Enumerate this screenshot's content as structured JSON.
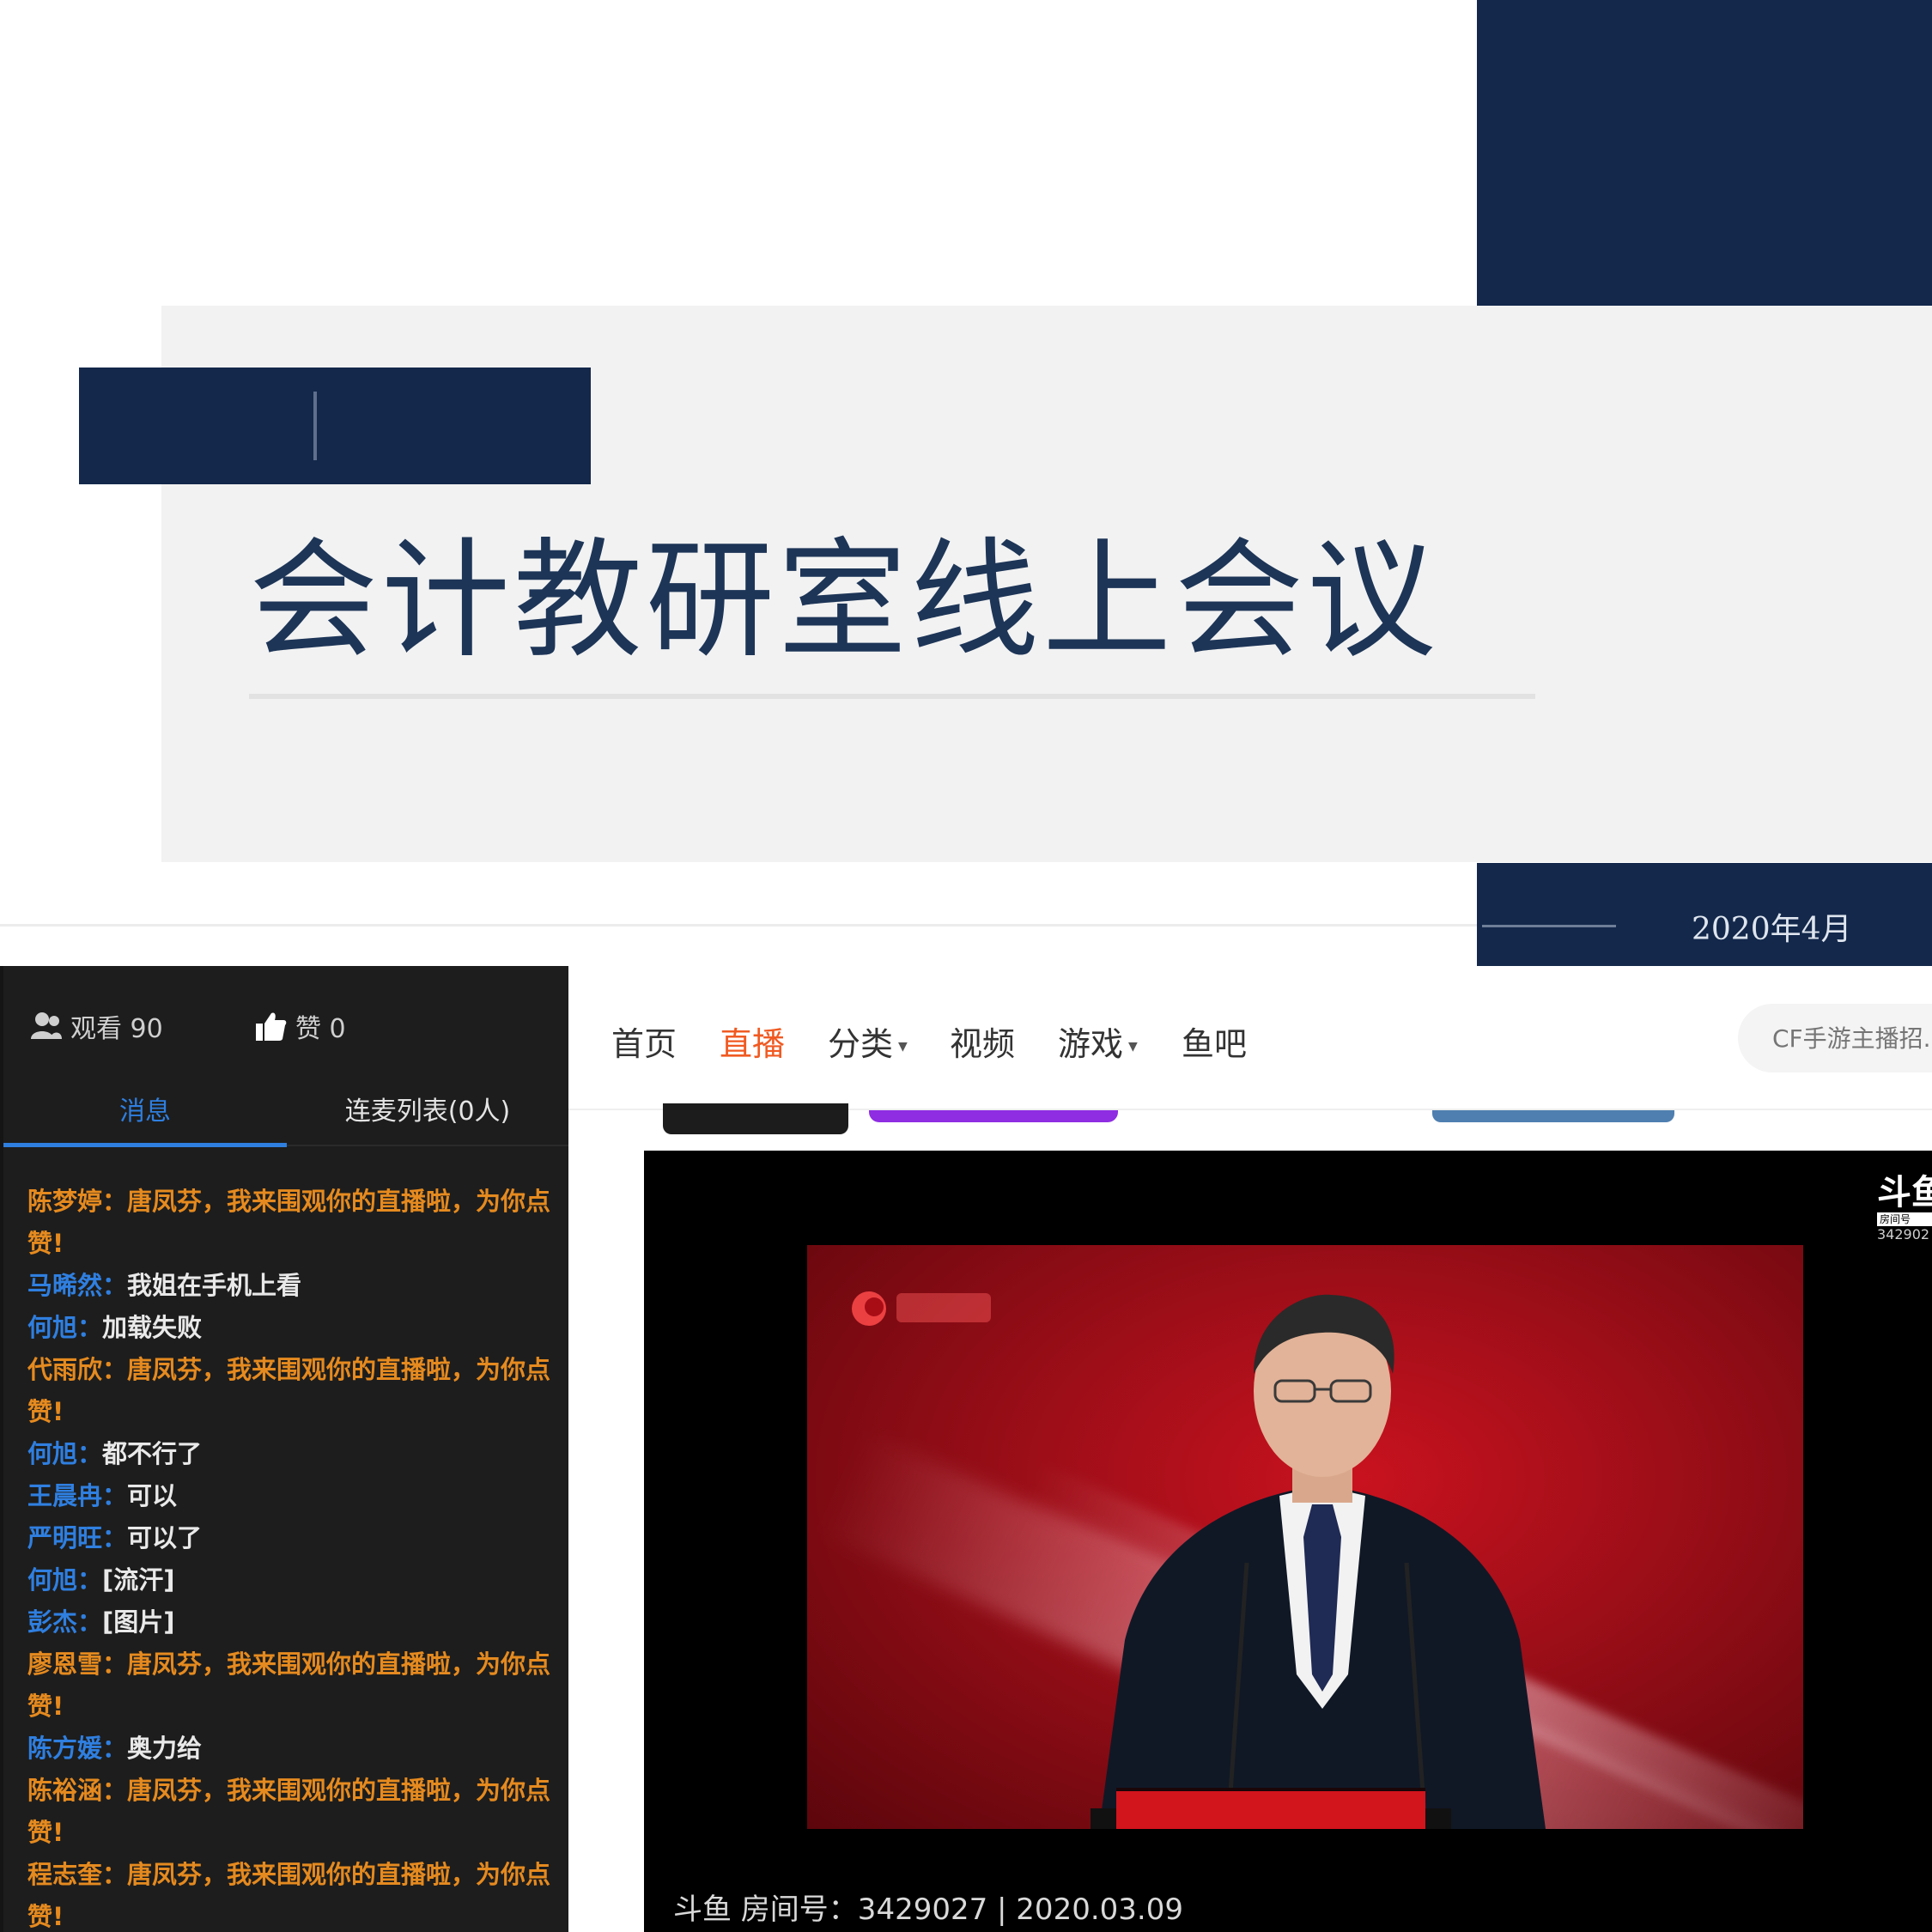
{
  "slide": {
    "title": "会计教研室线上会议",
    "date": "2020年4月"
  },
  "chat": {
    "viewers_label": "观看 90",
    "likes_label": "赞 0",
    "tabs": [
      {
        "label": "消息",
        "active": true
      },
      {
        "label": "连麦列表(0人)",
        "active": false
      }
    ],
    "messages": [
      {
        "name": "陈梦婷：",
        "text": "唐凤芬，我来围观你的直播啦，为你点赞!",
        "system": true
      },
      {
        "name": "马晞然：",
        "text": "我姐在手机上看",
        "system": false
      },
      {
        "name": "何旭：",
        "text": "加载失败",
        "system": false
      },
      {
        "name": "代雨欣：",
        "text": "唐凤芬，我来围观你的直播啦，为你点赞!",
        "system": true
      },
      {
        "name": "何旭：",
        "text": "都不行了",
        "system": false
      },
      {
        "name": "王晨冉：",
        "text": "可以",
        "system": false
      },
      {
        "name": "严明旺：",
        "text": "可以了",
        "system": false
      },
      {
        "name": "何旭：",
        "text": "[流汗]",
        "system": false
      },
      {
        "name": "彭杰：",
        "text": "[图片]",
        "system": false
      },
      {
        "name": "廖恩雪：",
        "text": "唐凤芬，我来围观你的直播啦，为你点赞!",
        "system": true
      },
      {
        "name": "陈方媛：",
        "text": "奥力给",
        "system": false
      },
      {
        "name": "陈裕涵：",
        "text": "唐凤芬，我来围观你的直播啦，为你点赞!",
        "system": true
      },
      {
        "name": "程志奎：",
        "text": "唐凤芬，我来围观你的直播啦，为你点赞!",
        "system": true
      }
    ],
    "accent_color": "#2f7fe0",
    "system_color": "#e58a1f"
  },
  "web": {
    "nav": [
      {
        "label": "首页",
        "active": false,
        "dropdown": false
      },
      {
        "label": "直播",
        "active": true,
        "dropdown": false
      },
      {
        "label": "分类",
        "active": false,
        "dropdown": true
      },
      {
        "label": "视频",
        "active": false,
        "dropdown": false
      },
      {
        "label": "游戏",
        "active": false,
        "dropdown": true
      },
      {
        "label": "鱼吧",
        "active": false,
        "dropdown": false
      }
    ],
    "search_placeholder": "CF手游主播招...",
    "active_color": "#f05a22",
    "player": {
      "watermark_logo": "斗鱼",
      "watermark_room": "房间号",
      "watermark_num": "342902",
      "caption": "斗鱼 房间号：3429027 | 2020.03.09"
    }
  }
}
